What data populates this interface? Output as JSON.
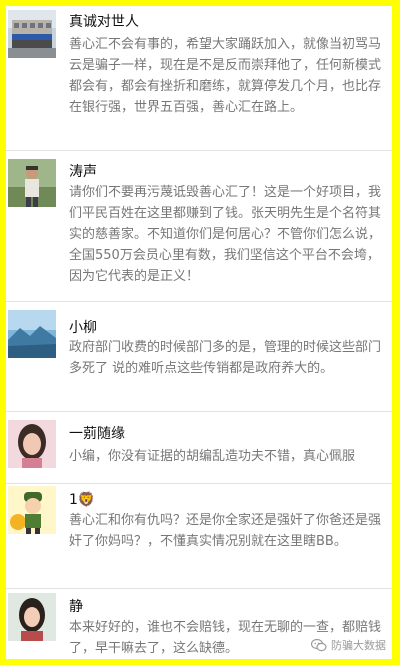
{
  "comments": [
    {
      "name": "真诚对世人",
      "text": "善心汇不会有事的，希望大家踊跃加入，就像当初骂马云是骗子一样，现在是不是反而崇拜他了，任何新模式都会有，都会有挫折和磨练，就算停发几个月，也比存在银行强，世界五百强，善心汇在路上。",
      "avatar": "building-photo-avatar"
    },
    {
      "name": "涛声",
      "text": "请你们不要再污蔑诋毁善心汇了！这是一个好项目，我们平民百姓在这里都赚到了钱。张天明先生是个名符其实的慈善家。不知道你们是何居心？不管你们怎么说，全国550万会员心里有数，我们坚信这个平台不会垮，因为它代表的是正义！",
      "avatar": "man-outdoors-avatar"
    },
    {
      "name": "小柳",
      "text": "政府部门收费的时候部门多的是，管理的时候这些部门多死了 说的难听点这些传销都是政府养大的。",
      "avatar": "landscape-avatar"
    },
    {
      "name": "一莂随缘",
      "text": "小编，你没有证据的胡编乱造功夫不错，真心佩服",
      "avatar": "woman-portrait-avatar"
    },
    {
      "name": "1🦁",
      "text": "善心汇和你有仇吗？还是你全家还是强奸了你爸还是强奸了你妈吗？，不懂真实情况别就在这里瞎BB。",
      "avatar": "cartoon-soldier-avatar"
    },
    {
      "name": "静",
      "text": "本来好好的，谁也不会赔钱，现在无聊的一查，都赔钱了，早干嘛去了，这么缺德。",
      "avatar": "girl-portrait-avatar"
    }
  ],
  "watermark": {
    "text": "防骗大数据",
    "icon": "wechat-icon"
  },
  "colors": {
    "frame": "#ffff00",
    "text": "#777777",
    "name": "#111111"
  }
}
